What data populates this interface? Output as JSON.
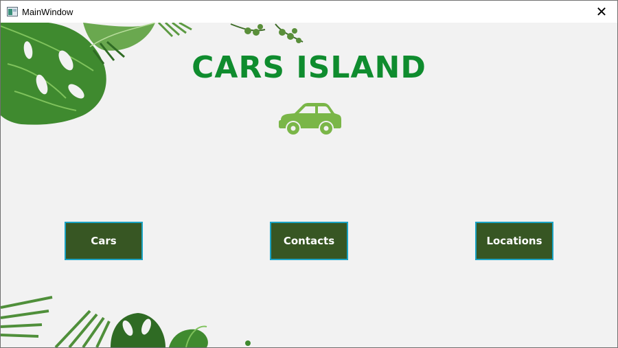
{
  "window": {
    "title": "MainWindow",
    "app_icon": "app-window-icon",
    "close_glyph": "✕"
  },
  "main": {
    "heading": "CARS ISLAND",
    "car_icon": "car-icon",
    "buttons": [
      {
        "label": "Cars"
      },
      {
        "label": "Contacts"
      },
      {
        "label": "Locations"
      }
    ]
  },
  "colors": {
    "heading": "#0f8c2e",
    "button_fill": "#375623",
    "button_border": "#1aa3c4",
    "car_icon": "#7ab648",
    "background": "#f2f2f2"
  }
}
